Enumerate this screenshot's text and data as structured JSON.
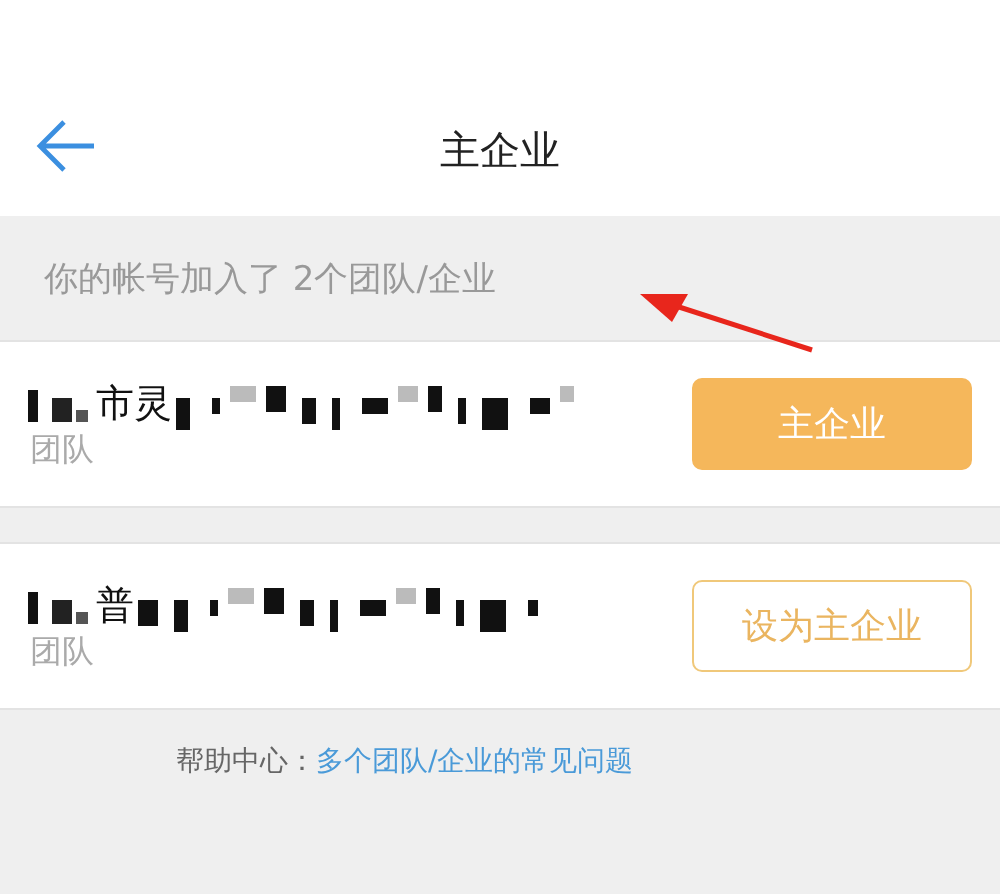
{
  "header": {
    "title": "主企业"
  },
  "notice": "你的帐号加入了 2个团队/企业",
  "teams": [
    {
      "name": "市灵",
      "type": "团队",
      "is_main": true,
      "button": "主企业"
    },
    {
      "name": "普",
      "type": "团队",
      "is_main": false,
      "button": "设为主企业"
    }
  ],
  "help": {
    "label": "帮助中心：",
    "link": "多个团队/企业的常见问题"
  }
}
